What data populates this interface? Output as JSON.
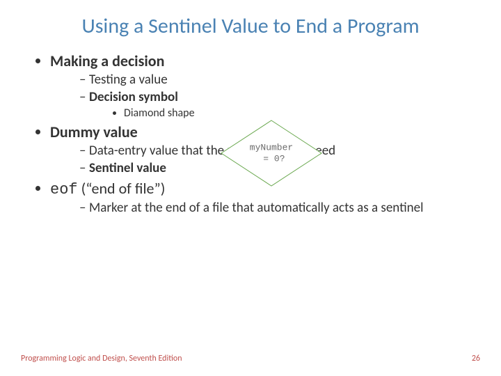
{
  "title": "Using a Sentinel Value to End a Program",
  "bullets": {
    "b1": "Making a decision",
    "b1_1": "Testing a value",
    "b1_2": "Decision symbol",
    "b1_2_1": "Diamond shape",
    "b2": "Dummy value",
    "b2_1": "Data-entry value that the user will never need",
    "b2_2": "Sentinel value",
    "b3_mono": "eof",
    "b3_rest": " (“end of file”)",
    "b3_1": "Marker at the end of a file that automatically acts as a sentinel"
  },
  "diagram": {
    "label": "myNumber\n = 0?"
  },
  "footer": {
    "left": "Programming Logic and Design, Seventh Edition",
    "right": "26"
  }
}
